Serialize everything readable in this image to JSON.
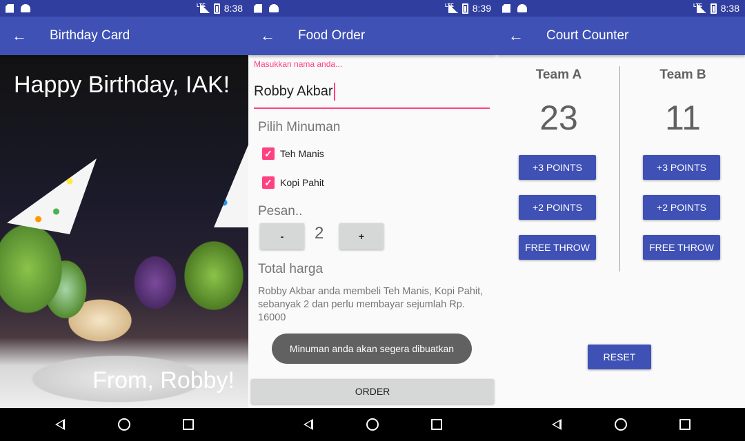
{
  "status_bars": [
    {
      "time": "8:38",
      "network": "LTE"
    },
    {
      "time": "8:39",
      "network": "LTE"
    },
    {
      "time": "8:38",
      "network": "LTE"
    }
  ],
  "birthday": {
    "title": "Birthday Card",
    "greeting": "Happy Birthday, IAK!",
    "from": "From, Robby!"
  },
  "food": {
    "title": "Food Order",
    "name_hint": "Masukkan nama anda...",
    "name_value": "Robby Akbar",
    "drinks_heading": "Pilih Minuman",
    "drinks": [
      {
        "label": "Teh Manis",
        "checked": true
      },
      {
        "label": "Kopi Pahit",
        "checked": true
      }
    ],
    "quantity_heading": "Pesan..",
    "decrement_label": "-",
    "quantity": "2",
    "increment_label": "+",
    "total_heading": "Total harga",
    "summary": "Robby Akbar anda  membeli Teh Manis, Kopi Pahit, sebanyak 2 dan perlu membayar sejumlah Rp. 16000",
    "toast": "Minuman anda akan segera dibuatkan",
    "order_label": "ORDER"
  },
  "court": {
    "title": "Court Counter",
    "team_a": {
      "name": "Team A",
      "score": "23"
    },
    "team_b": {
      "name": "Team B",
      "score": "11"
    },
    "btn_three": "+3 POINTS",
    "btn_two": "+2 POINTS",
    "btn_free": "FREE THROW",
    "reset_label": "RESET"
  },
  "colors": {
    "primary": "#3f51b5",
    "primary_dark": "#303f9f",
    "accent": "#ff4081"
  }
}
